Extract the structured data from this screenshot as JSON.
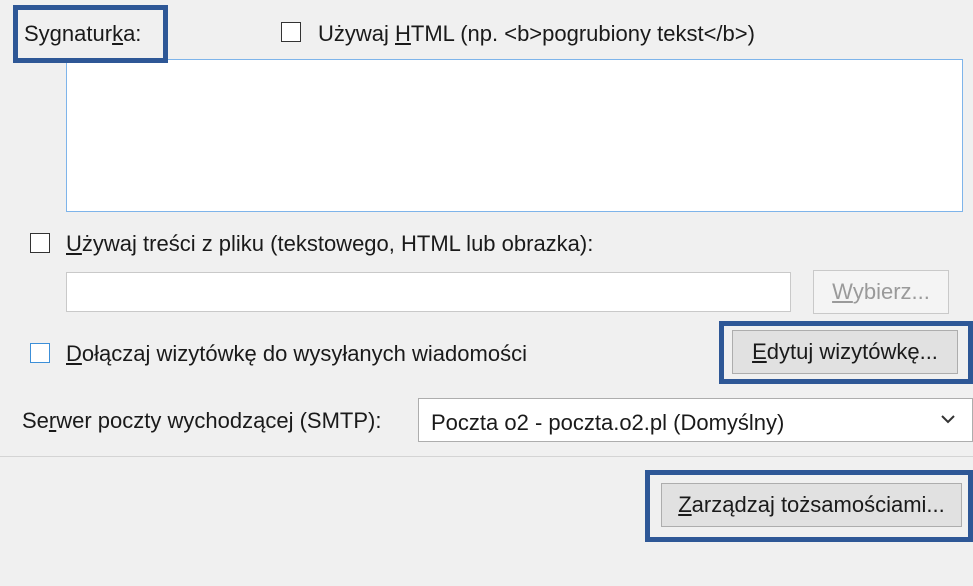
{
  "signature": {
    "label_prefix": "Sygnatur",
    "label_mnemonic": "k",
    "label_suffix": "a:",
    "use_html_prefix": "Używaj ",
    "use_html_mnemonic": "H",
    "use_html_suffix": "TML (np. <b>pogrubiony tekst</b>)",
    "use_html_checked": false,
    "text": ""
  },
  "file_option": {
    "label_mnemonic": "U",
    "label_suffix": "żywaj treści z pliku (tekstowego, HTML lub obrazka):",
    "checked": false,
    "path": "",
    "choose_mnemonic": "W",
    "choose_suffix": "ybierz..."
  },
  "vcard": {
    "label_mnemonic": "D",
    "label_suffix": "ołączaj wizytówkę do wysyłanych wiadomości",
    "checked": false,
    "edit_mnemonic": "E",
    "edit_suffix": "dytuj wizytówkę..."
  },
  "smtp": {
    "label_prefix": "Se",
    "label_mnemonic": "r",
    "label_suffix": "wer poczty wychodzącej (SMTP):",
    "selected": "Poczta o2 - poczta.o2.pl (Domyślny)"
  },
  "manage": {
    "mnemonic": "Z",
    "suffix": "arządzaj tożsamościami..."
  },
  "colors": {
    "highlight": "#2e5796",
    "focus_border": "#7eb4ea",
    "checkbox_accent": "#3c8fd8"
  }
}
